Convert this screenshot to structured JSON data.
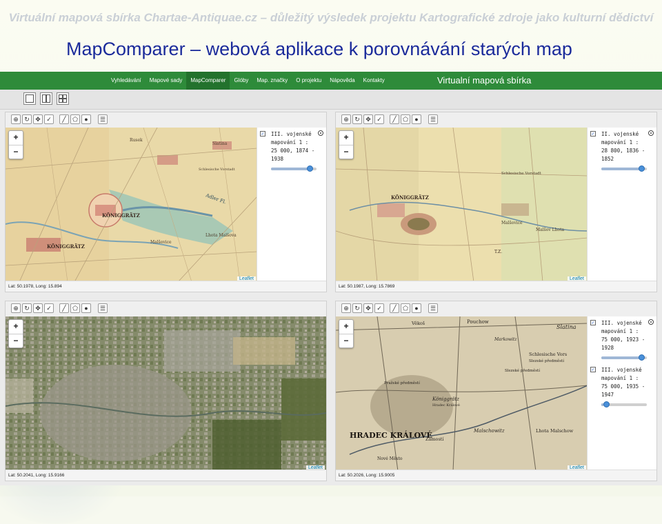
{
  "slide": {
    "subtitle": "Virtuální mapová sbírka Chartae-Antiquae.cz – důležitý výsledek projektu Kartografické zdroje jako kulturní dědictví",
    "title": "MapComparer – webová aplikace k porovnávání starých map"
  },
  "navbar": {
    "items": [
      {
        "label": "Vyhledávání"
      },
      {
        "label": "Mapové sady"
      },
      {
        "label": "MapComparer"
      },
      {
        "label": "Glóby"
      },
      {
        "label": "Map. značky"
      },
      {
        "label": "O projektu"
      },
      {
        "label": "Nápověda"
      },
      {
        "label": "Kontakty"
      }
    ],
    "active": "MapComparer",
    "brand": "Virtualní mapová sbírka"
  },
  "map_labels": {
    "zoom_in": "+",
    "zoom_out": "−",
    "attribution": "Leaflet"
  },
  "panels": [
    {
      "coords": "Lat: 50.1978, Long: 15.894",
      "map_texts": [
        "Slatina",
        "Rusek",
        "Schlesische Vorstadt",
        "KÖNIGGRÄTZ",
        "Malšovice",
        "Lhota Malšova",
        "KÖNIGGRÄTZ",
        "Adler Fl."
      ],
      "layers": [
        {
          "title": "III. vojenské mapování 1 : 25 000, 1874 - 1938",
          "checked": true,
          "opacity": 0.92
        }
      ]
    },
    {
      "coords": "Lat: 50.1987, Long: 15.7869",
      "map_texts": [
        "Schlesische Vorstadt",
        "KÖNIGGRÄTZ",
        "T.Z.",
        "Malšovice",
        "Malšov Lhota"
      ],
      "layers": [
        {
          "title": "II. vojenské mapování 1 : 28 800, 1836 - 1852",
          "checked": true,
          "opacity": 0.95
        }
      ]
    },
    {
      "coords": "Lat: 50.2041, Long: 15.9166",
      "map_texts": [],
      "layers": []
    },
    {
      "coords": "Lat: 50.2026, Long: 15.9005",
      "map_texts": [
        "Věkoš",
        "Pouchow",
        "Slatina",
        "Markowitz",
        "Schlesische Vors",
        "Slezské předměstí",
        "Pražské předměstí",
        "Königgrätz",
        "Hradec Králové",
        "HRADEC KRÁLOVÉ",
        "Malschowitz",
        "Lhota Malschow",
        "Zámostí",
        "Nové Město",
        "Slezské předměstí"
      ],
      "layers": [
        {
          "title": "III. vojenské mapování 1 : 75 000, 1923 - 1928",
          "checked": true,
          "opacity": 0.95
        },
        {
          "title": "III. vojenské mapování 1 : 75 000, 1935 - 1947",
          "checked": true,
          "opacity": 0.05
        }
      ]
    }
  ],
  "colors": {
    "navbar": "#2e8b3a",
    "title": "#1b2b9b",
    "subtitle": "#c9cfd6"
  },
  "icons": [
    "square-layout-icon",
    "two-column-layout-icon",
    "four-grid-layout-icon",
    "circle-plus-icon",
    "refresh-icon",
    "move-icon",
    "check-icon",
    "line-draw-icon",
    "polygon-draw-icon",
    "circle-draw-icon",
    "legend-icon"
  ]
}
